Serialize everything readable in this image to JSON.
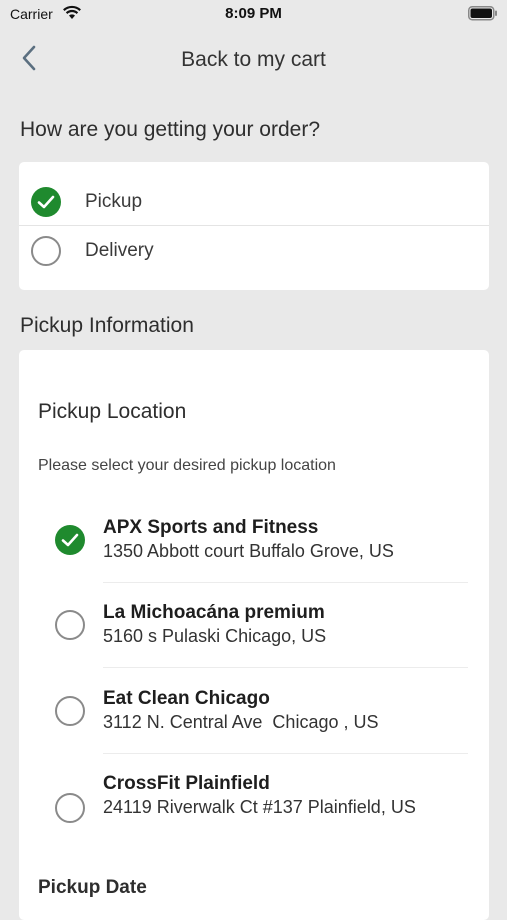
{
  "status_bar": {
    "carrier": "Carrier",
    "time": "8:09 PM"
  },
  "nav": {
    "back_label": "Back to my cart"
  },
  "fulfillment": {
    "question": "How are you getting your order?",
    "options": [
      {
        "label": "Pickup",
        "selected": true
      },
      {
        "label": "Delivery",
        "selected": false
      }
    ]
  },
  "pickup_info": {
    "heading": "Pickup Information",
    "location_heading": "Pickup Location",
    "location_hint": "Please select your desired pickup location",
    "locations": [
      {
        "name": "APX Sports and Fitness",
        "address": "1350 Abbott court Buffalo Grove, US",
        "selected": true
      },
      {
        "name": "La Michoacána premium",
        "address": "5160 s Pulaski Chicago, US",
        "selected": false
      },
      {
        "name": "Eat Clean Chicago",
        "address": "3112 N. Central Ave  Chicago , US",
        "selected": false
      },
      {
        "name": "CrossFit Plainfield",
        "address": "24119 Riverwalk Ct #137 Plainfield, US",
        "selected": false
      }
    ],
    "date_heading": "Pickup Date"
  },
  "colors": {
    "accent_green": "#1f8a2e",
    "background": "#e9e9e9",
    "card": "#ffffff"
  },
  "icons": {
    "back": "chevron-left-icon",
    "selected": "check-circle-icon",
    "unselected": "radio-empty-icon"
  }
}
